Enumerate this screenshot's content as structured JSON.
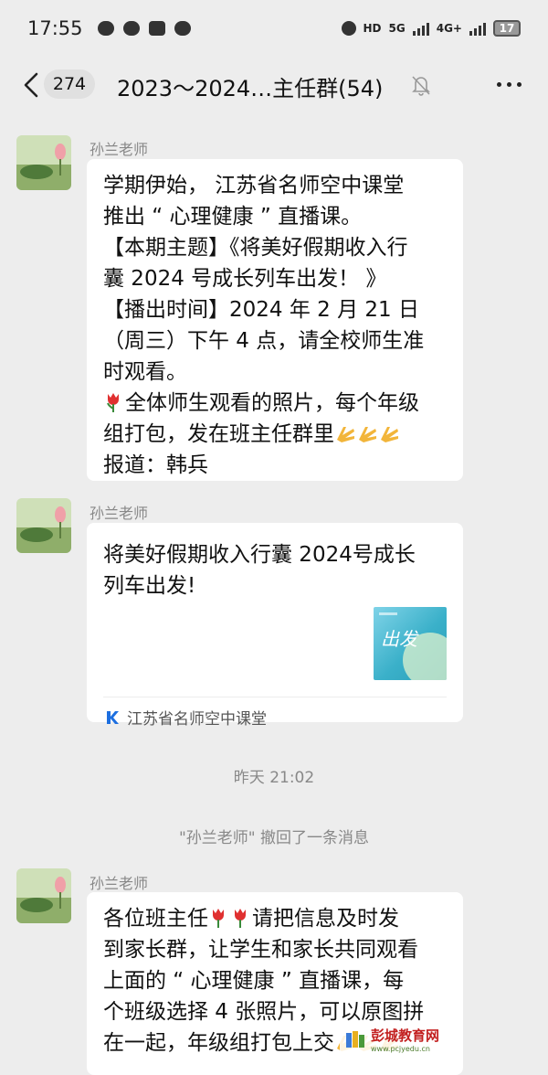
{
  "status_bar": {
    "time": "17:55",
    "network_labels": [
      "HD",
      "5G",
      "4G+"
    ],
    "battery": "17"
  },
  "header": {
    "unread_count": "274",
    "title": "2023～2024…主任群(54)",
    "icons": [
      "back-arrow-icon",
      "muted-bell-icon",
      "more-icon"
    ]
  },
  "messages": [
    {
      "sender": "孙兰老师",
      "lines": [
        "学期伊始， 江苏省名师空中课堂",
        "推出 “ 心理健康 ” 直播课。",
        "【本期主题】《将美好假期收入行",
        "囊 2024 号成长列车出发！ 》",
        "【播出时间】2024 年 2 月 21 日",
        "（周三）下午 4 点，请全校师生准",
        "时观看。"
      ],
      "line8": "全体师生观看的照片，每个年级",
      "line9": "组打包，发在班主任群里",
      "line10": "报道：韩兵"
    },
    {
      "sender": "孙兰老师",
      "card_title_1": "将美好假期收入行囊 2024号成长",
      "card_title_2": "列车出发!",
      "thumb_text": "出发",
      "source": "江苏省名师空中课堂"
    },
    {
      "sender": "孙兰老师",
      "line1": "各位班主任",
      "line1b": "请把信息及时发",
      "lines": [
        "到家长群，让学生和家长共同观看",
        "上面的 “ 心理健康 ” 直播课，每",
        "个班级选择 4 张照片，可以原图拼"
      ],
      "line5": "在一起，年级组打包上交"
    }
  ],
  "system": {
    "timestamp": "昨天 21:02",
    "recall_notice": "\"孙兰老师\" 撤回了一条消息"
  },
  "watermark": {
    "name": "彭城教育网",
    "url": "www.pcjyedu.cn"
  },
  "colors": {
    "background": "#ededed",
    "bubble": "#ffffff",
    "secondary_text": "#888888",
    "accent_link": "#1d6fe0"
  }
}
